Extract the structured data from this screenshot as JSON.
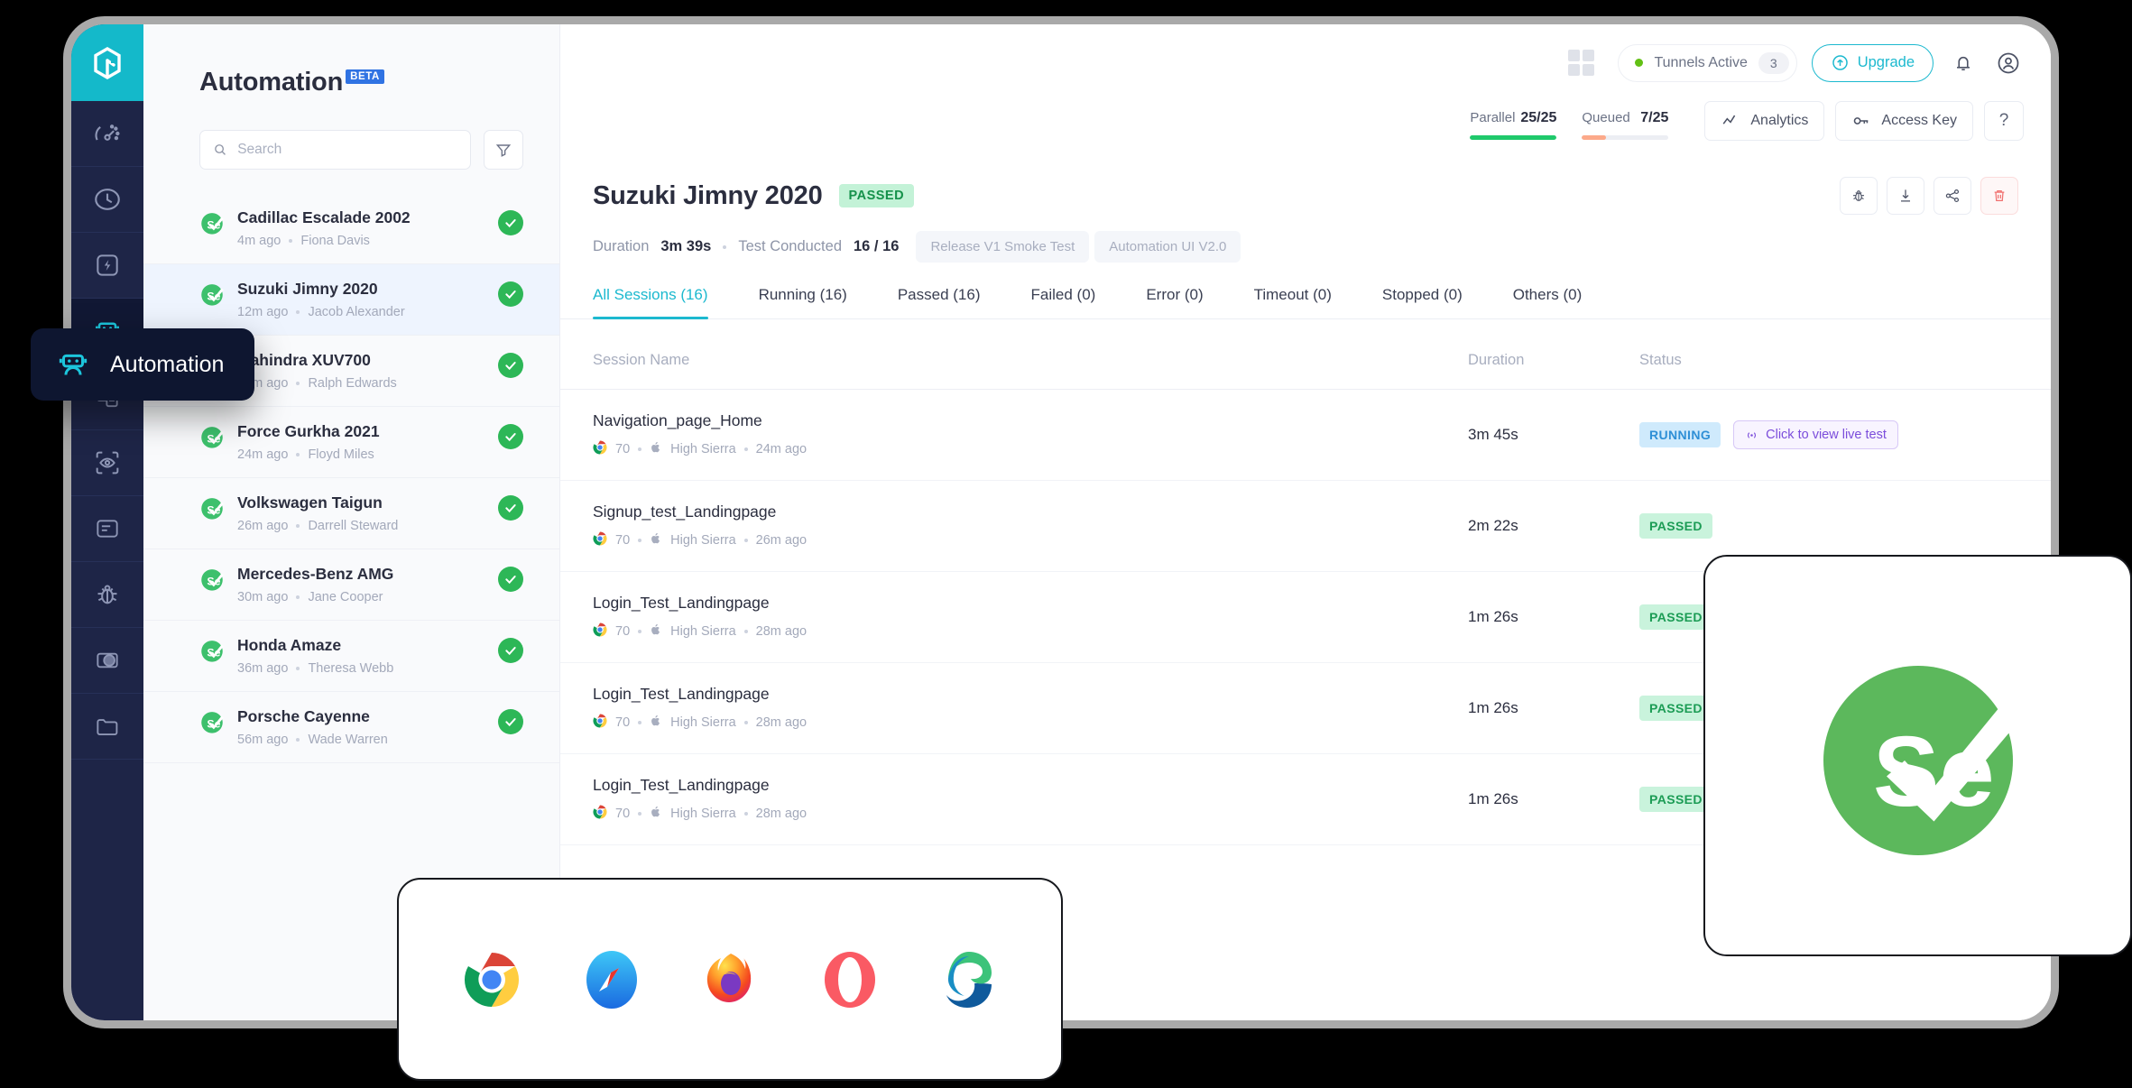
{
  "brand": {
    "logo_icon": "lambdatest-logo-icon",
    "accent": "#1cb9cf",
    "rail_bg": "#1e2547"
  },
  "rail": {
    "items": [
      {
        "icon": "speedometer-icon",
        "name": "dashboard"
      },
      {
        "icon": "clock-icon",
        "name": "history"
      },
      {
        "icon": "lightning-bolt-icon",
        "name": "realtime"
      },
      {
        "icon": "robot-icon",
        "name": "automation",
        "active": true
      },
      {
        "icon": "documents-icon",
        "name": "test-logs"
      },
      {
        "icon": "eye-scan-icon",
        "name": "visual-testing"
      },
      {
        "icon": "list-card-icon",
        "name": "reports"
      },
      {
        "icon": "bug-icon",
        "name": "issues"
      },
      {
        "icon": "contrast-circle-icon",
        "name": "appearance"
      },
      {
        "icon": "folder-icon",
        "name": "projects"
      }
    ],
    "tooltip": {
      "label": "Automation",
      "icon": "robot-icon"
    }
  },
  "sidebar": {
    "title": "Automation",
    "badge": "BETA",
    "search": {
      "placeholder": "Search",
      "value": "",
      "icon": "search-icon"
    },
    "filter_icon": "funnel-filter-icon",
    "builds": [
      {
        "name": "Cadillac Escalade 2002",
        "time": "4m ago",
        "user": "Fiona Davis",
        "status": "passed"
      },
      {
        "name": "Suzuki Jimny 2020",
        "time": "12m ago",
        "user": "Jacob Alexander",
        "status": "passed",
        "selected": true
      },
      {
        "name": "Mahindra XUV700",
        "time": "17m ago",
        "user": "Ralph Edwards",
        "status": "passed"
      },
      {
        "name": "Force Gurkha 2021",
        "time": "24m ago",
        "user": "Floyd Miles",
        "status": "passed"
      },
      {
        "name": "Volkswagen Taigun",
        "time": "26m ago",
        "user": "Darrell Steward",
        "status": "passed"
      },
      {
        "name": "Mercedes-Benz AMG",
        "time": "30m ago",
        "user": "Jane Cooper",
        "status": "passed"
      },
      {
        "name": "Honda Amaze",
        "time": "36m ago",
        "user": "Theresa Webb",
        "status": "passed"
      },
      {
        "name": "Porsche Cayenne",
        "time": "56m ago",
        "user": "Wade Warren",
        "status": "passed"
      }
    ]
  },
  "topbar": {
    "grid_icon": "grid-apps-icon",
    "tunnels": {
      "label": "Tunnels Active",
      "count": "3",
      "dot_color": "#62c014"
    },
    "upgrade": {
      "label": "Upgrade",
      "icon": "arrow-up-circle-icon"
    },
    "notification_icon": "bell-icon",
    "account_icon": "user-avatar-icon"
  },
  "stats": {
    "parallel": {
      "label": "Parallel",
      "value": "25/25",
      "percent": 100,
      "color": "#1fc96b"
    },
    "queued": {
      "label": "Queued",
      "value": "7/25",
      "percent": 28,
      "color": "#fca98a"
    },
    "analytics": {
      "label": "Analytics",
      "icon": "analytics-line-icon"
    },
    "access_key": {
      "label": "Access Key",
      "icon": "key-icon"
    },
    "help": {
      "label": "?"
    }
  },
  "detail": {
    "title": "Suzuki Jimny 2020",
    "status_badge": "PASSED",
    "duration_label": "Duration",
    "duration_value": "3m 39s",
    "tests_label": "Test Conducted",
    "tests_value": "16 / 16",
    "tags": [
      "Release V1 Smoke Test",
      "Automation UI V2.0"
    ],
    "actions": [
      {
        "icon": "bug-icon",
        "name": "report-bug-button"
      },
      {
        "icon": "download-icon",
        "name": "download-button"
      },
      {
        "icon": "share-icon",
        "name": "share-button"
      },
      {
        "icon": "trash-icon",
        "name": "delete-button",
        "danger": true
      }
    ]
  },
  "tabs": [
    {
      "label": "All Sessions (16)",
      "active": true
    },
    {
      "label": "Running (16)"
    },
    {
      "label": "Passed (16)"
    },
    {
      "label": "Failed (0)"
    },
    {
      "label": "Error (0)"
    },
    {
      "label": "Timeout (0)"
    },
    {
      "label": "Stopped (0)"
    },
    {
      "label": "Others (0)"
    }
  ],
  "sessions": {
    "columns": {
      "name": "Session Name",
      "duration": "Duration",
      "status": "Status"
    },
    "rows": [
      {
        "name": "Navigation_page_Home",
        "browser_icon": "chrome-icon",
        "browser_version": "70",
        "os_icon": "apple-icon",
        "os": "High Sierra",
        "time": "24m ago",
        "duration": "3m 45s",
        "status": "RUNNING",
        "status_type": "running",
        "live_label": "Click to view live test",
        "live_icon": "broadcast-icon"
      },
      {
        "name": "Signup_test_Landingpage",
        "browser_icon": "chrome-icon",
        "browser_version": "70",
        "os_icon": "apple-icon",
        "os": "High Sierra",
        "time": "26m ago",
        "duration": "2m 22s",
        "status": "PASSED",
        "status_type": "passed"
      },
      {
        "name": "Login_Test_Landingpage",
        "browser_icon": "chrome-icon",
        "browser_version": "70",
        "os_icon": "apple-icon",
        "os": "High Sierra",
        "time": "28m ago",
        "duration": "1m 26s",
        "status": "PASSED",
        "status_type": "passed"
      },
      {
        "name": "Login_Test_Landingpage",
        "browser_icon": "chrome-icon",
        "browser_version": "70",
        "os_icon": "apple-icon",
        "os": "High Sierra",
        "time": "28m ago",
        "duration": "1m 26s",
        "status": "PASSED",
        "status_type": "passed"
      },
      {
        "name": "Login_Test_Landingpage",
        "browser_icon": "chrome-icon",
        "browser_version": "70",
        "os_icon": "apple-icon",
        "os": "High Sierra",
        "time": "28m ago",
        "duration": "1m 26s",
        "status": "PASSED",
        "status_type": "passed"
      }
    ]
  },
  "browser_card": {
    "browsers": [
      {
        "name": "chrome-icon"
      },
      {
        "name": "safari-icon"
      },
      {
        "name": "firefox-icon"
      },
      {
        "name": "opera-icon"
      },
      {
        "name": "edge-icon"
      }
    ]
  },
  "selenium_card": {
    "icon": "selenium-logo-icon",
    "color": "#5cb85c"
  }
}
